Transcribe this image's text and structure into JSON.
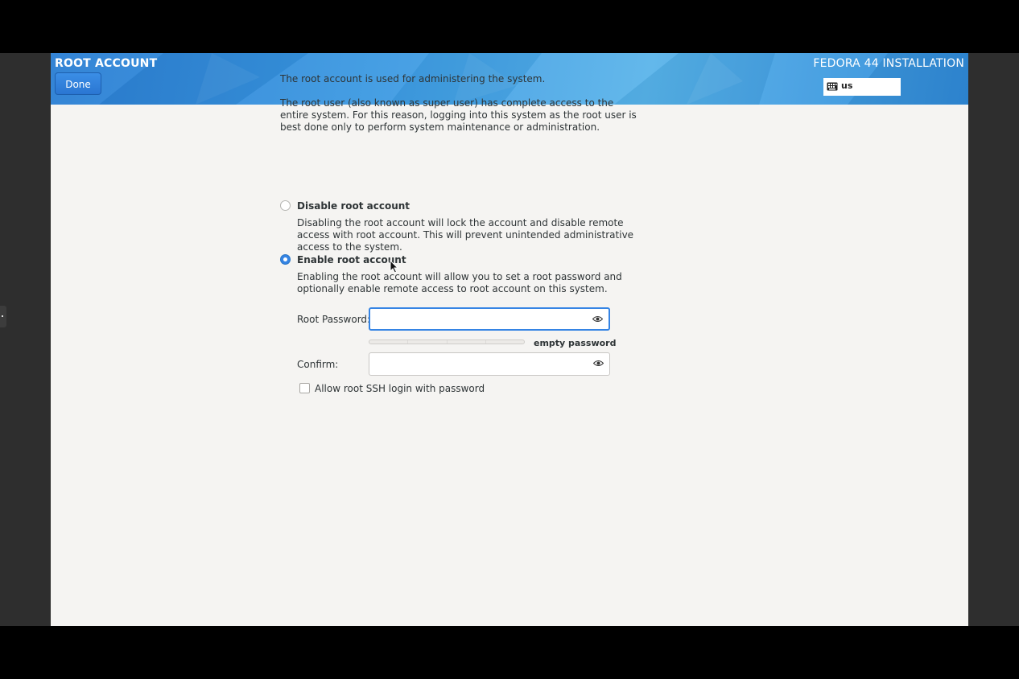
{
  "header": {
    "spoke_title": "ROOT ACCOUNT",
    "done_label": "Done",
    "product_title": "FEDORA 44 INSTALLATION",
    "keyboard_layout": "us",
    "keyboard_icon": "keyboard-icon"
  },
  "intro": {
    "line1": "The root account is used for administering the system.",
    "line2": "The root user (also known as super user) has complete access to the entire system. For this reason, logging into this system as the root user is best done only to perform system maintenance or administration."
  },
  "options": {
    "disable": {
      "label": "Disable root account",
      "description": "Disabling the root account will lock the account and disable remote access with root account. This will prevent unintended administrative access to the system.",
      "selected": false
    },
    "enable": {
      "label": "Enable root account",
      "description": "Enabling the root account will allow you to set a root password and optionally enable remote access to root account on this system.",
      "selected": true
    }
  },
  "password": {
    "root_label": "Root Password:",
    "root_value": "",
    "strength_text": "empty password",
    "strength_level": 0,
    "confirm_label": "Confirm:",
    "confirm_value": "",
    "reveal_icon": "eye-icon"
  },
  "ssh": {
    "label": "Allow root SSH login with password",
    "checked": false
  },
  "colors": {
    "accent": "#3584e4",
    "header_blue": "#3a98e2",
    "background": "#f5f4f2"
  }
}
